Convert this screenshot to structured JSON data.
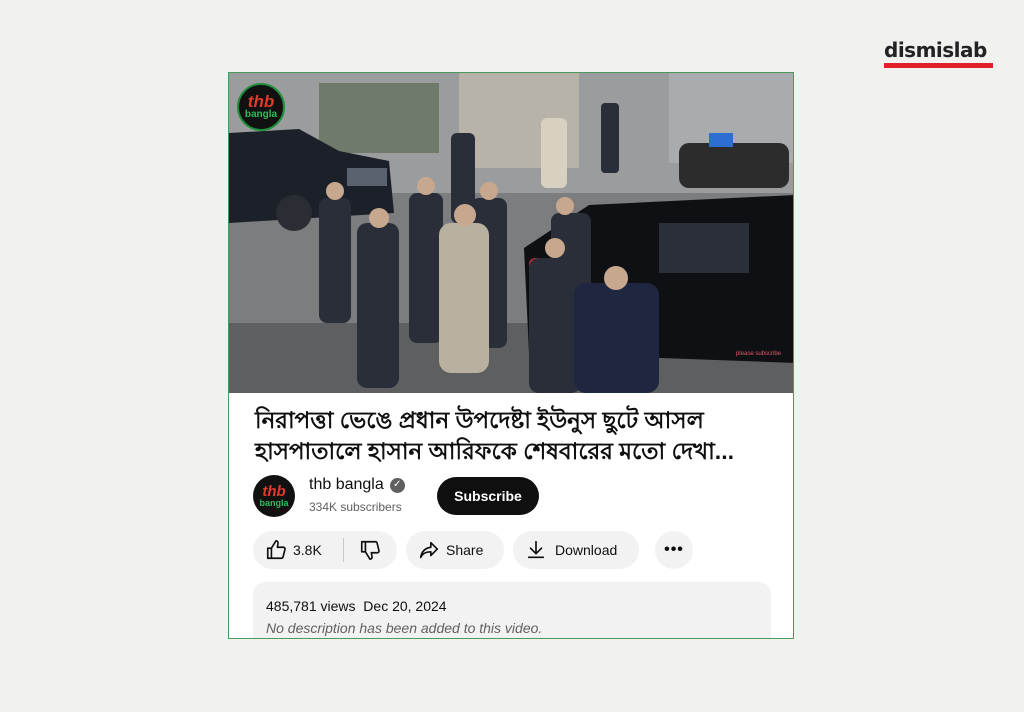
{
  "brand": {
    "logo_text": "dismislab"
  },
  "video": {
    "overlay_logo_top": "thb",
    "overlay_logo_bottom": "bangla",
    "watermark": "please subscribe"
  },
  "title": "নিরাপত্তা ভেঙে প্রধান উপদেষ্টা ইউনুস ছুটে আসল হাসপাতালে হাসান আরিফকে শেষবারের মতো দেখা...",
  "channel": {
    "avatar_top": "thb",
    "avatar_bottom": "bangla",
    "name": "thb bangla",
    "verified_icon": "✓",
    "subscribers": "334K subscribers",
    "subscribe_label": "Subscribe"
  },
  "actions": {
    "likes": "3.8K",
    "share_label": "Share",
    "download_label": "Download",
    "more_label": "•••"
  },
  "description": {
    "views": "485,781 views",
    "date": "Dec 20, 2024",
    "text": "No description has been added to this video."
  },
  "colors": {
    "accent_red": "#e3202a",
    "card_border": "#4a9a5c",
    "subscribe_bg": "#0f0f0f"
  }
}
